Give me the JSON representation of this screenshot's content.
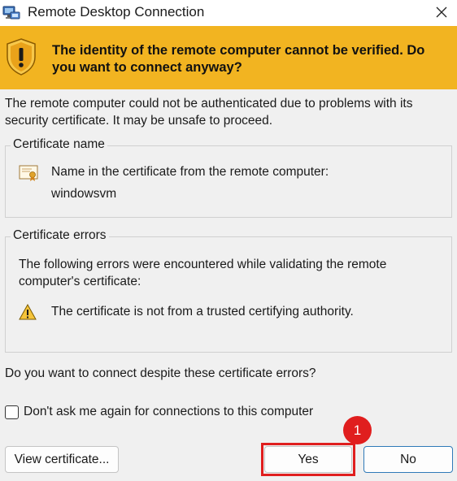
{
  "window": {
    "title": "Remote Desktop Connection",
    "app_icon": "remote-desktop-icon",
    "close_icon": "close-icon"
  },
  "banner": {
    "icon": "warning-shield-icon",
    "color": "#f2b421",
    "text": "The identity of the remote computer cannot be verified. Do you want to connect anyway?"
  },
  "intro": "The remote computer could not be authenticated due to problems with its security certificate. It may be unsafe to proceed.",
  "certificate_name": {
    "legend": "Certificate name",
    "icon": "certificate-icon",
    "line1": "Name in the certificate from the remote computer:",
    "line2": "windowsvm"
  },
  "certificate_errors": {
    "legend": "Certificate errors",
    "description": "The following errors were encountered while validating the remote computer's certificate:",
    "icon": "warning-icon",
    "item": "The certificate is not from a trusted certifying authority."
  },
  "question": "Do you want to connect despite these certificate errors?",
  "checkbox": {
    "label": "Don't ask me again for connections to this computer",
    "checked": false
  },
  "buttons": {
    "view_certificate": "View certificate...",
    "yes": "Yes",
    "no": "No"
  },
  "annotation": {
    "step_number": "1",
    "color": "#e01e1e"
  }
}
